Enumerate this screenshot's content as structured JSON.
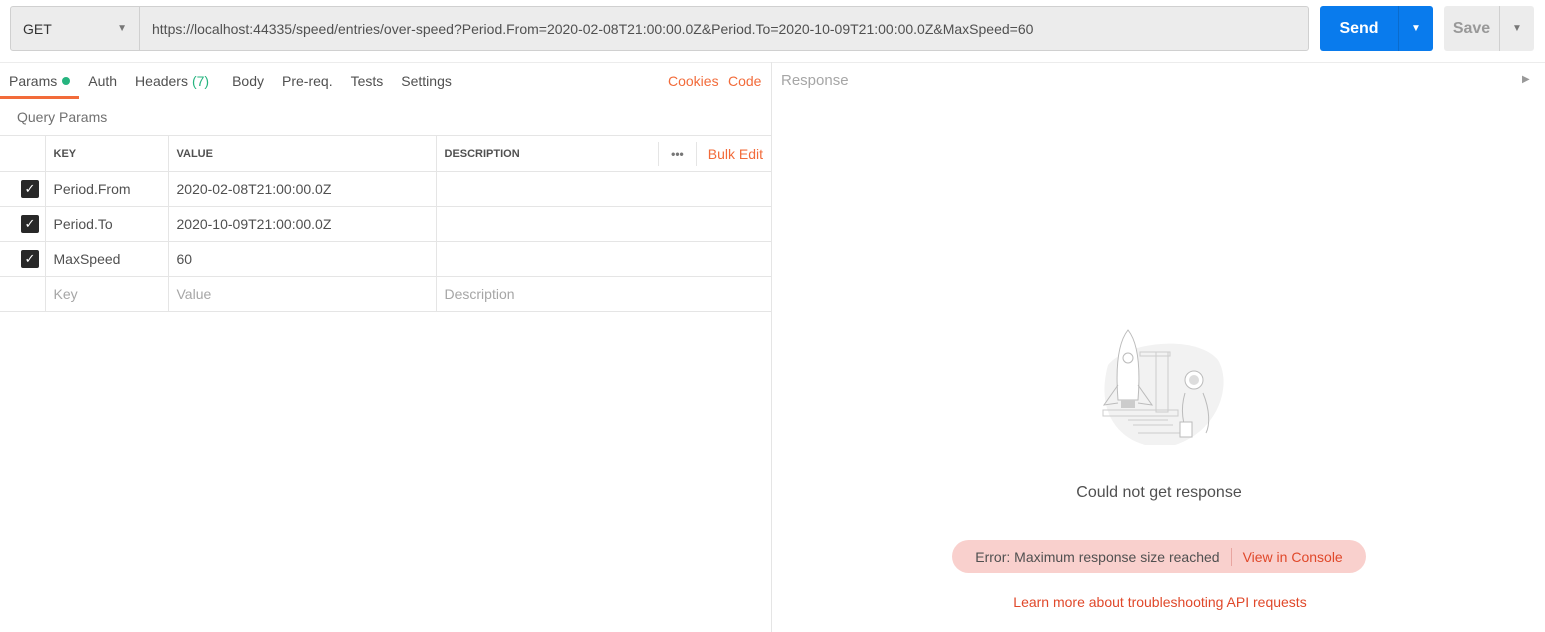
{
  "request": {
    "method": "GET",
    "url": "https://localhost:44335/speed/entries/over-speed?Period.From=2020-02-08T21:00:00.0Z&Period.To=2020-10-09T21:00:00.0Z&MaxSpeed=60",
    "send_label": "Send",
    "save_label": "Save"
  },
  "tabs": [
    {
      "label": "Params"
    },
    {
      "label": "Auth"
    },
    {
      "label": "Headers",
      "count": "(7)"
    },
    {
      "label": "Body"
    },
    {
      "label": "Pre-req."
    },
    {
      "label": "Tests"
    },
    {
      "label": "Settings"
    }
  ],
  "links": {
    "cookies": "Cookies",
    "code": "Code"
  },
  "query_params": {
    "title": "Query Params",
    "headers": {
      "key": "KEY",
      "value": "VALUE",
      "description": "DESCRIPTION",
      "more": "•••",
      "bulk_edit": "Bulk Edit"
    },
    "rows": [
      {
        "key": "Period.From",
        "value": "2020-02-08T21:00:00.0Z",
        "description": "",
        "checked": true
      },
      {
        "key": "Period.To",
        "value": "2020-10-09T21:00:00.0Z",
        "description": "",
        "checked": true
      },
      {
        "key": "MaxSpeed",
        "value": "60",
        "description": "",
        "checked": true
      }
    ],
    "placeholders": {
      "key": "Key",
      "value": "Value",
      "description": "Description"
    }
  },
  "response": {
    "title": "Response",
    "message": "Could not get response",
    "error": "Error: Maximum response size reached",
    "view_console": "View in Console",
    "learn_more": "Learn more about troubleshooting API requests"
  },
  "colors": {
    "accent": "#f26b3a",
    "send": "#097bed",
    "error_bg": "#f9d0cd"
  }
}
